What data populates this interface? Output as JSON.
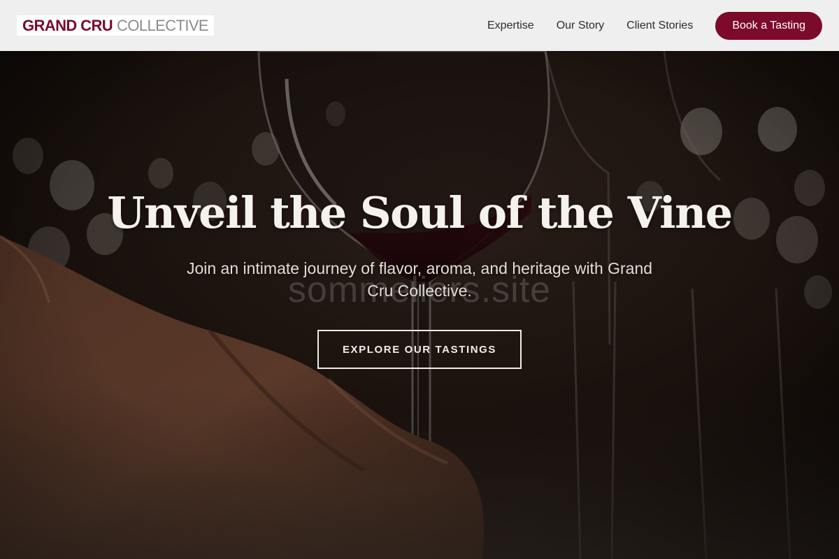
{
  "header": {
    "logo_strong": "GRAND CRU",
    "logo_light": "COLLECTIVE",
    "nav_items": [
      {
        "label": "Expertise"
      },
      {
        "label": "Our Story"
      },
      {
        "label": "Client Stories"
      }
    ],
    "cta_label": "Book a Tasting"
  },
  "hero": {
    "title": "Unveil the Soul of the Vine",
    "subtitle": "Join an intimate journey of flavor, aroma, and heritage with Grand Cru Collective.",
    "watermark": "sommeliers.site",
    "cta_label": "EXPLORE OUR TASTINGS",
    "background_icon": "wine-glass-tasting-photo"
  },
  "colors": {
    "brand": "#7c0a2a",
    "navbar_background": "#efefef",
    "hero_text": "#f5f1ec"
  }
}
